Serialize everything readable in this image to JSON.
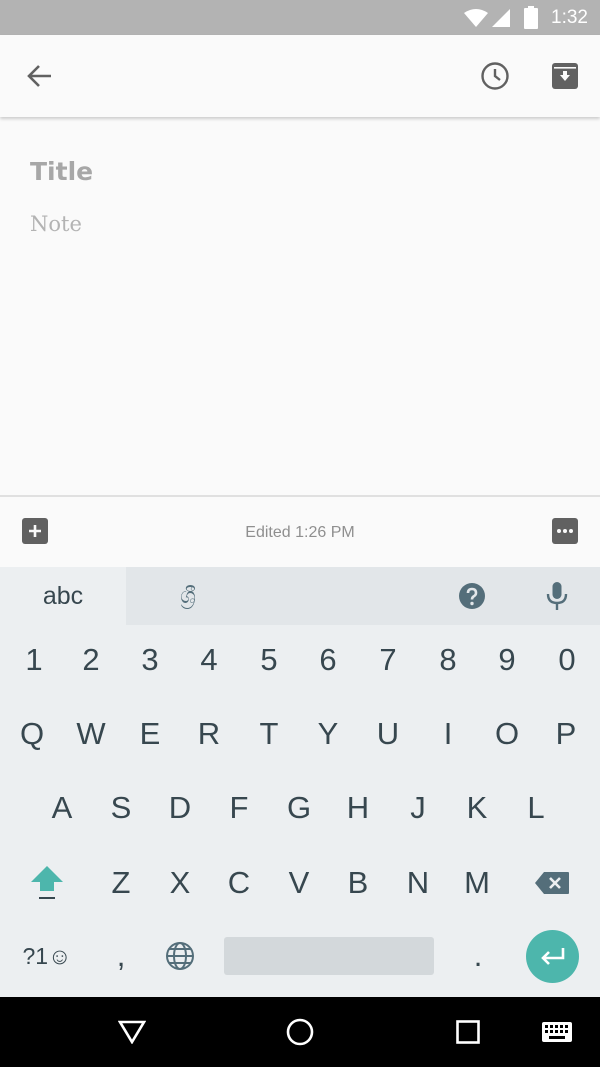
{
  "status_bar": {
    "time": "1:32",
    "icons": [
      "wifi-icon",
      "signal-icon",
      "battery-icon"
    ]
  },
  "toolbar": {
    "icons": [
      "back-arrow-icon",
      "reminder-clock-icon",
      "archive-icon"
    ]
  },
  "note": {
    "title_placeholder": "Title",
    "body_placeholder": "Note"
  },
  "bottom_bar": {
    "edited_text": "Edited 1:26 PM",
    "icons": [
      "add-box-icon",
      "more-icon"
    ]
  },
  "keyboard": {
    "mode_label": "abc",
    "lang_label": "ශ්‍රී",
    "number_row": [
      "1",
      "2",
      "3",
      "4",
      "5",
      "6",
      "7",
      "8",
      "9",
      "0"
    ],
    "row1": [
      "Q",
      "W",
      "E",
      "R",
      "T",
      "Y",
      "U",
      "I",
      "O",
      "P"
    ],
    "row2": [
      "A",
      "S",
      "D",
      "F",
      "G",
      "H",
      "J",
      "K",
      "L"
    ],
    "row3": [
      "Z",
      "X",
      "C",
      "V",
      "B",
      "N",
      "M"
    ],
    "symbols_label": "?1☺",
    "comma_label": ",",
    "period_label": ".",
    "accent_color": "#4db6ac"
  },
  "nav_bar": {
    "icons": [
      "back-triangle-icon",
      "home-circle-icon",
      "recents-square-icon",
      "keyboard-switch-icon"
    ]
  }
}
